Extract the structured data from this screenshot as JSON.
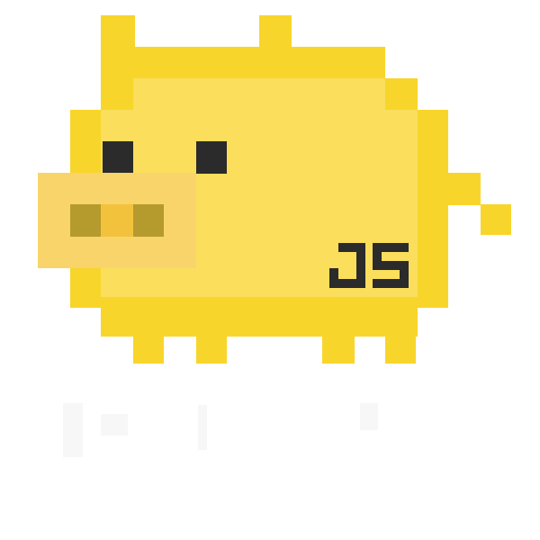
{
  "logo": {
    "text": "JS",
    "colors": {
      "body_outline": "#F8D52B",
      "body_fill": "#FADE5C",
      "snout": "#F8D46A",
      "nostril": "#B59A2E",
      "nostril_center": "#F3C23C",
      "eye": "#2A2B2A",
      "background": "#FFFFFF"
    }
  }
}
